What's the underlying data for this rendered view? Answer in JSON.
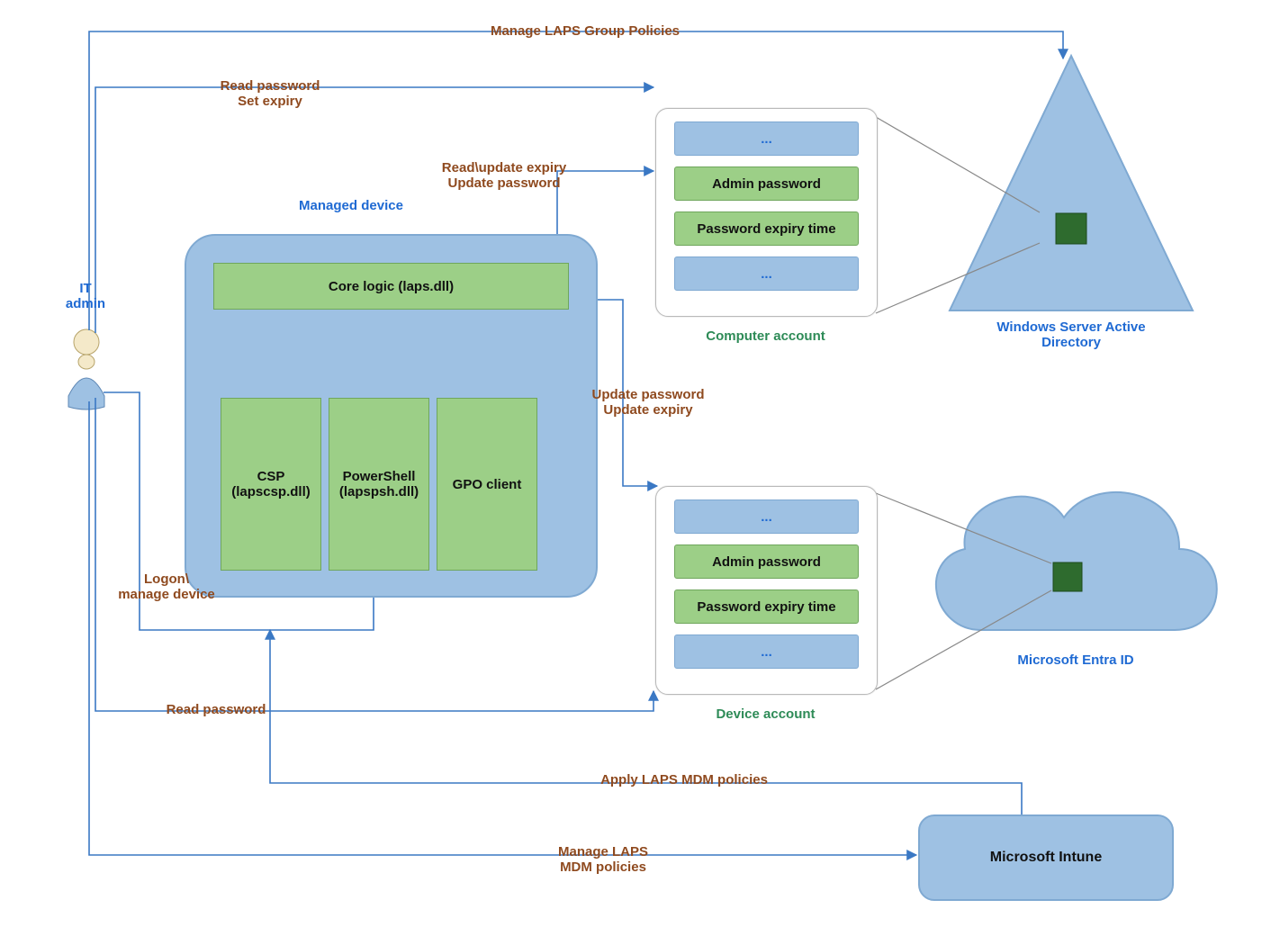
{
  "actors": {
    "it_admin": "IT\nadmin"
  },
  "managed_device": {
    "title": "Managed device",
    "core_logic": "Core logic (laps.dll)",
    "csp": "CSP\n(lapscsp.dll)",
    "powershell": "PowerShell\n(lapspsh.dll)",
    "gpo": "GPO client"
  },
  "accounts": {
    "computer": {
      "title": "Computer account",
      "admin_pw": "Admin password",
      "pw_expiry": "Password expiry time",
      "ellipsis_top": "...",
      "ellipsis_bottom": "..."
    },
    "device": {
      "title": "Device account",
      "admin_pw": "Admin password",
      "pw_expiry": "Password expiry time",
      "ellipsis_top": "...",
      "ellipsis_bottom": "..."
    }
  },
  "targets": {
    "ad": "Windows Server Active\nDirectory",
    "entra": "Microsoft Entra ID",
    "intune": "Microsoft Intune"
  },
  "edges": {
    "manage_gpo": "Manage LAPS Group Policies",
    "read_pw_set_expiry": "Read password\nSet expiry",
    "read_update_expiry": "Read\\update expiry\nUpdate password",
    "update_pw_expiry": "Update password\nUpdate expiry",
    "logon_manage": "Logon\\\nmanage device",
    "read_pw": "Read password",
    "apply_mdm": "Apply LAPS MDM policies",
    "manage_mdm": "Manage LAPS\nMDM policies"
  },
  "colors": {
    "blue_fill": "#9ec1e3",
    "blue_stroke": "#3a78c4",
    "green_fill": "#9ccf87",
    "dark_green": "#2e6b2e",
    "edge_text": "#8f4a1f"
  }
}
